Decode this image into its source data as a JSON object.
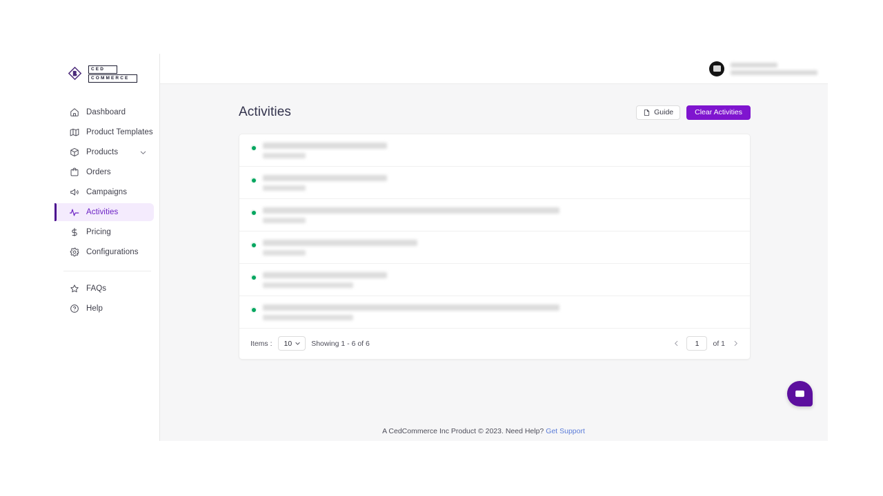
{
  "brand": {
    "logo_line_top": "CED",
    "logo_line_bottom": "COMMERCE",
    "logo_icon": "cedcommerce-diamond-logo"
  },
  "sidebar": {
    "items": [
      {
        "label": "Dashboard",
        "icon": "home-icon",
        "active": false,
        "expandable": false
      },
      {
        "label": "Product Templates",
        "icon": "map-icon",
        "active": false,
        "expandable": false
      },
      {
        "label": "Products",
        "icon": "box-icon",
        "active": false,
        "expandable": true
      },
      {
        "label": "Orders",
        "icon": "bag-icon",
        "active": false,
        "expandable": false
      },
      {
        "label": "Campaigns",
        "icon": "megaphone-icon",
        "active": false,
        "expandable": false
      },
      {
        "label": "Activities",
        "icon": "activity-pulse-icon",
        "active": true,
        "expandable": false
      },
      {
        "label": "Pricing",
        "icon": "dollar-icon",
        "active": false,
        "expandable": false
      },
      {
        "label": "Configurations",
        "icon": "gear-icon",
        "active": false,
        "expandable": false
      }
    ],
    "bottom_items": [
      {
        "label": "FAQs",
        "icon": "star-icon"
      },
      {
        "label": "Help",
        "icon": "question-circle-icon"
      }
    ]
  },
  "topbar": {
    "avatar_icon": "user-avatar",
    "user_name_redacted": true,
    "user_email_redacted": true
  },
  "page": {
    "title": "Activities",
    "guide_button": "Guide",
    "guide_icon": "document-icon",
    "clear_button": "Clear Activities"
  },
  "activities": {
    "rows": [
      {
        "status": "success",
        "title_width": 180,
        "sub_width": 62
      },
      {
        "status": "success",
        "title_width": 180,
        "sub_width": 62
      },
      {
        "status": "success",
        "title_width": 430,
        "sub_width": 62
      },
      {
        "status": "success",
        "title_width": 224,
        "sub_width": 62
      },
      {
        "status": "success",
        "title_width": 180,
        "sub_width": 131
      },
      {
        "status": "success",
        "title_width": 430,
        "sub_width": 131
      }
    ]
  },
  "pagination": {
    "items_label": "Items :",
    "page_size": "10",
    "showing_text": "Showing 1 - 6 of 6",
    "prev_icon": "chevron-left-icon",
    "next_icon": "chevron-right-icon",
    "current_page": "1",
    "of_label": "of  1"
  },
  "footer": {
    "text": "A CedCommerce Inc Product © 2023. Need Help?",
    "link": "Get Support"
  },
  "chat": {
    "icon": "chat-bubble-icon"
  },
  "colors": {
    "primary_purple": "#7f15cf",
    "active_purple": "#6b21c4",
    "active_bar": "#4b0f8f",
    "active_bg": "#f4ebfd",
    "status_green": "#06a660",
    "link_blue": "#5b7cd8",
    "chat_purple": "#5c0f9e",
    "content_bg": "#f6f6f7"
  }
}
